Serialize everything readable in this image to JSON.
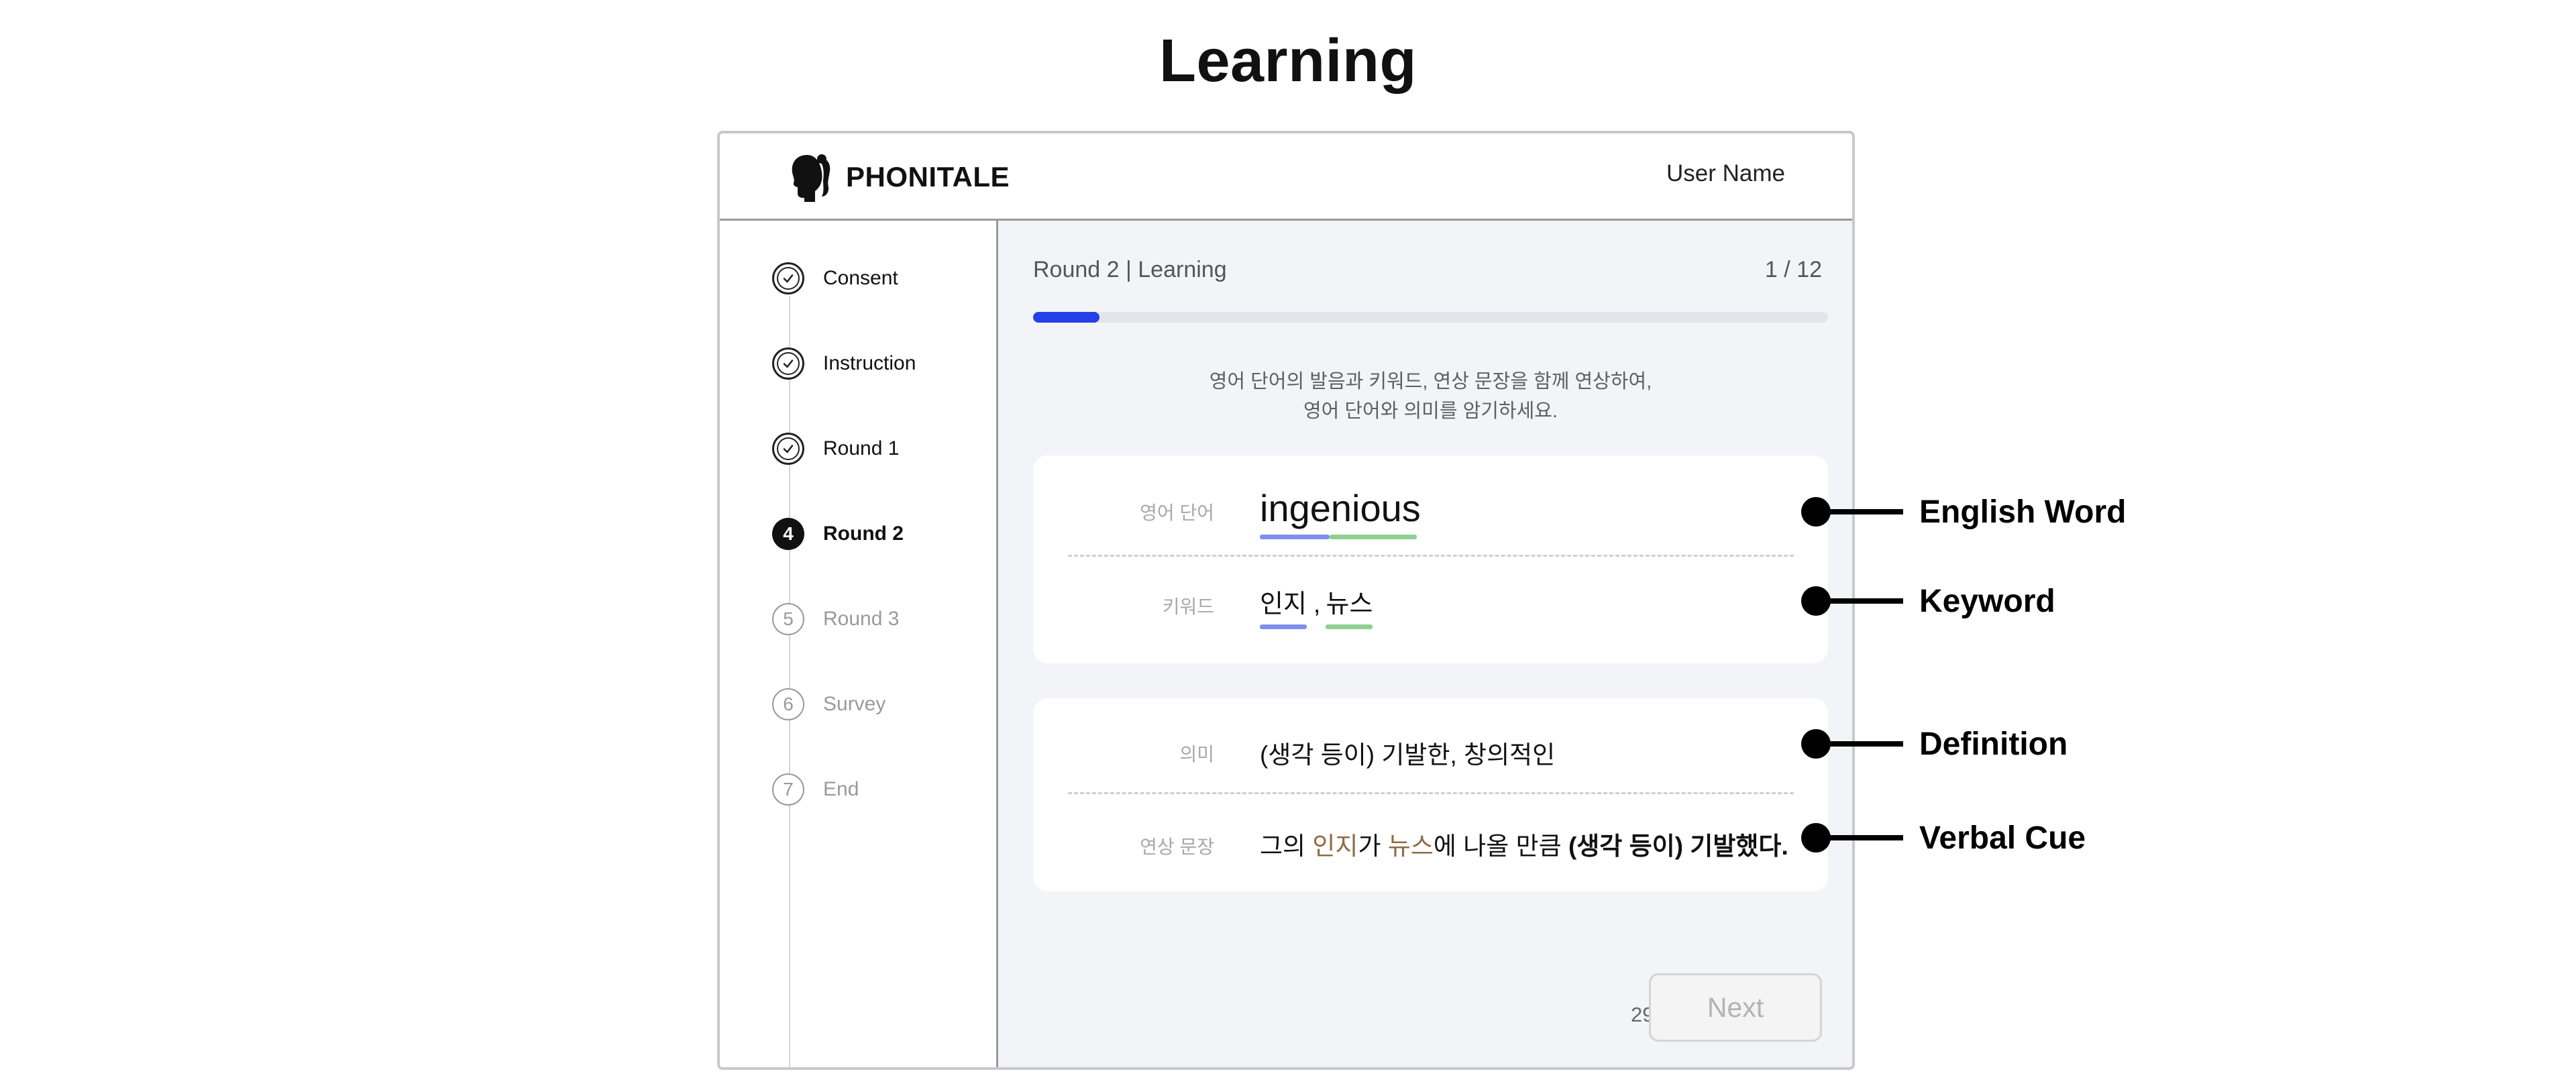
{
  "page_title": "Learning",
  "header": {
    "brand": "PHONITALE",
    "user_name": "User Name"
  },
  "steps": [
    {
      "number": "1",
      "label": "Consent",
      "status": "done"
    },
    {
      "number": "2",
      "label": "Instruction",
      "status": "done"
    },
    {
      "number": "3",
      "label": "Round 1",
      "status": "done"
    },
    {
      "number": "4",
      "label": "Round 2",
      "status": "current"
    },
    {
      "number": "5",
      "label": "Round 3",
      "status": "upcoming"
    },
    {
      "number": "6",
      "label": "Survey",
      "status": "upcoming"
    },
    {
      "number": "7",
      "label": "End",
      "status": "upcoming"
    }
  ],
  "main": {
    "round_title": "Round 2 | Learning",
    "counter": "1 / 12",
    "progress_current": 1,
    "progress_total": 12,
    "instruction_line1": "영어 단어의 발음과 키워드, 연상 문장을 함께 연상하여,",
    "instruction_line2": "영어 단어와 의미를 암기하세요."
  },
  "word_card": {
    "word_label": "영어 단어",
    "word": "ingenious",
    "keyword_label": "키워드",
    "keywords": [
      "인지",
      "뉴스"
    ],
    "keyword_separator": ","
  },
  "meaning_card": {
    "definition_label": "의미",
    "definition": "(생각 등이) 기발한, 창의적인",
    "cue_label": "연상 문장",
    "cue_parts": {
      "p1": "그의 ",
      "kw1": "인지",
      "p2": "가 ",
      "kw2": "뉴스",
      "p3": "에 나올 만큼 ",
      "bold": "(생각 등이) 기발했다."
    }
  },
  "footer": {
    "timer": "29s",
    "next_label": "Next"
  },
  "annotations": {
    "english_word": "English Word",
    "keyword": "Keyword",
    "definition": "Definition",
    "verbal_cue": "Verbal Cue"
  },
  "colors": {
    "progress": "#2440e6",
    "keyword_1": "#7e8ff0",
    "keyword_2": "#8fcf8f",
    "cue_keyword": "#8c6b45"
  }
}
